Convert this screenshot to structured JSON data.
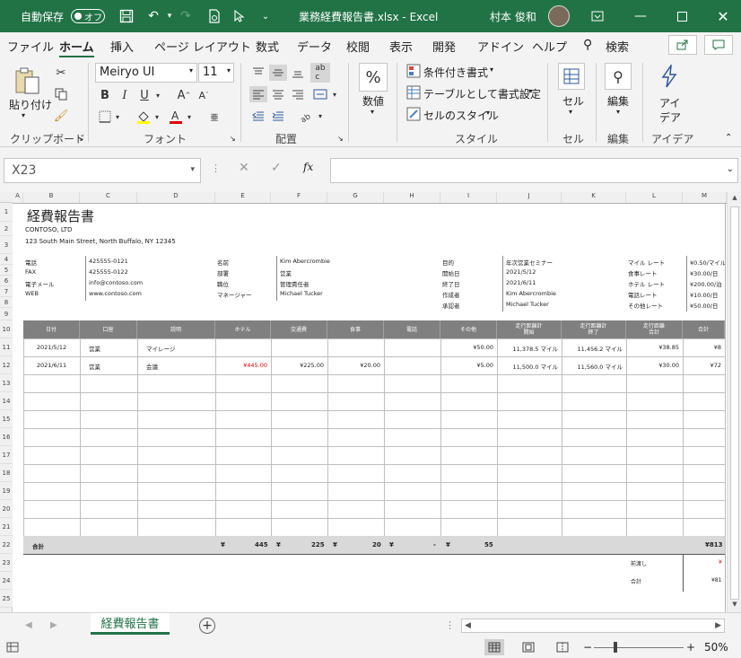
{
  "titlebar": {
    "autosave_label": "自動保存",
    "autosave_state": "オフ",
    "file_title": "業務経費報告書.xlsx  -  Excel",
    "user_name": "村本 俊和"
  },
  "menu": {
    "tabs": [
      "ファイル",
      "ホーム",
      "挿入",
      "ページ レイアウト",
      "数式",
      "データ",
      "校閲",
      "表示",
      "開発",
      "アドイン",
      "ヘルプ",
      "検索"
    ],
    "active": "ホーム"
  },
  "ribbon": {
    "clipboard": {
      "paste": "貼り付け",
      "label": "クリップボード"
    },
    "font": {
      "name": "Meiryo UI",
      "size": "11",
      "label": "フォント"
    },
    "alignment": {
      "label": "配置"
    },
    "number": {
      "label": "数値",
      "symbol": "%"
    },
    "styles": {
      "conditional": "条件付き書式",
      "table": "テーブルとして書式設定",
      "cell_style": "セルのスタイル",
      "label": "スタイル"
    },
    "cells": {
      "label": "セル"
    },
    "editing": {
      "label": "編集"
    },
    "ideas": {
      "label1": "アイ",
      "label2": "デア",
      "group": "アイデア"
    }
  },
  "formula": {
    "namebox": "X23",
    "fx": "fx",
    "value": ""
  },
  "columns": [
    "A",
    "B",
    "C",
    "D",
    "E",
    "F",
    "G",
    "H",
    "I",
    "J",
    "K",
    "L",
    "M"
  ],
  "rows": [
    "1",
    "2",
    "3",
    "4",
    "5",
    "6",
    "7",
    "8",
    "9",
    "10",
    "11",
    "12",
    "13",
    "14",
    "15",
    "16",
    "17",
    "18",
    "19",
    "20",
    "21",
    "22",
    "23",
    "24",
    "25"
  ],
  "report": {
    "title": "経費報告書",
    "company": "CONTOSO, LTD",
    "address": "123 South Main Street, North Buffalo, NY 12345",
    "contact": [
      {
        "label": "電話",
        "value": "425555-0121"
      },
      {
        "label": "FAX",
        "value": "425555-0122"
      },
      {
        "label": "電子メール",
        "value": "info@contoso.com"
      },
      {
        "label": "WEB",
        "value": "www.contoso.com"
      }
    ],
    "employee": [
      {
        "label": "名前",
        "value": "Kim Abercrombie"
      },
      {
        "label": "部署",
        "value": "営業"
      },
      {
        "label": "職位",
        "value": "管理責任者"
      },
      {
        "label": "マネージャー",
        "value": "Michael Tucker"
      }
    ],
    "trip": [
      {
        "label": "目的",
        "value": "年次営業セミナー"
      },
      {
        "label": "開始日",
        "value": "2021/5/12"
      },
      {
        "label": "終了日",
        "value": "2021/6/11"
      },
      {
        "label": "作成者",
        "value": "Kim Abercrombie"
      },
      {
        "label": "承認者",
        "value": "Michael Tucker"
      }
    ],
    "rates": [
      {
        "label": "マイル レート",
        "value": "¥0.50/マイル"
      },
      {
        "label": "食事レート",
        "value": "¥30.00/日"
      },
      {
        "label": "ホテル レート",
        "value": "¥200.00/泊"
      },
      {
        "label": "電話レート",
        "value": "¥10.00/日"
      },
      {
        "label": "その他レート",
        "value": "¥50.00/日"
      }
    ],
    "headers": [
      "日付",
      "口座",
      "説明",
      "ホテル",
      "交通費",
      "食事",
      "電話",
      "その他",
      "走行距離計\n開始",
      "走行距離計\n終了",
      "走行距離\n合計",
      "合計"
    ],
    "entries": [
      [
        "2021/5/12",
        "営業",
        "マイレージ",
        "",
        "",
        "",
        "",
        "¥50.00",
        "11,378.5  マイル",
        "11,456.2  マイル",
        "¥38.85",
        "¥8"
      ],
      [
        "2021/6/11",
        "営業",
        "会議",
        "¥445.00",
        "¥225.00",
        "¥20.00",
        "",
        "¥5.00",
        "11,500.0  マイル",
        "11,560.0  マイル",
        "¥30.00",
        "¥72"
      ]
    ],
    "totals": {
      "label": "合計",
      "hotel": "445",
      "transport": "225",
      "meals": "20",
      "phone": "-",
      "misc": "55",
      "total": "¥813"
    },
    "yen": "¥",
    "advance_label": "前渡し",
    "advance_value": "¥",
    "grand_label": "合計",
    "grand_value": "¥81"
  },
  "sheet_tab": "経費報告書",
  "zoom": "50%"
}
